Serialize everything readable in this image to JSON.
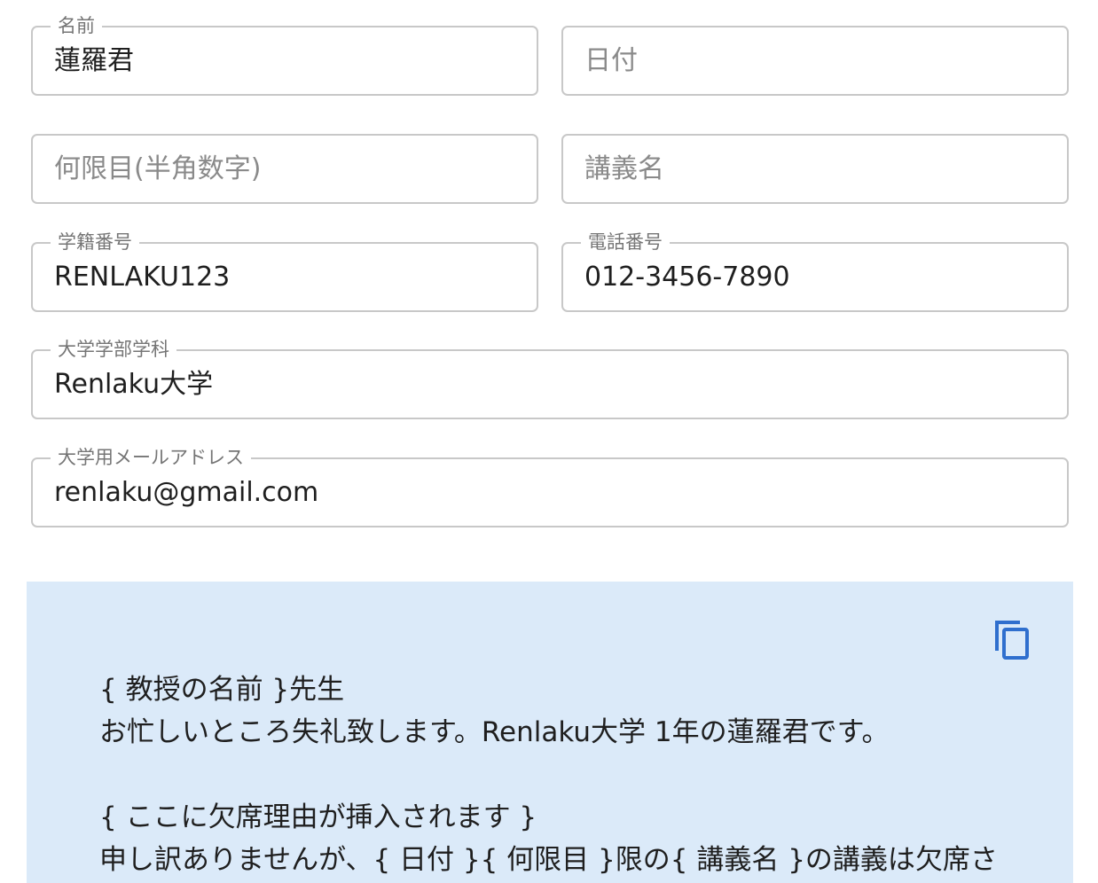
{
  "form": {
    "name": {
      "label": "名前",
      "value": "蓮羅君",
      "placeholder": ""
    },
    "date": {
      "label": "",
      "value": "",
      "placeholder": "日付"
    },
    "period": {
      "label": "",
      "value": "",
      "placeholder": "何限目(半角数字)"
    },
    "lecture": {
      "label": "",
      "value": "",
      "placeholder": "講義名"
    },
    "student_id": {
      "label": "学籍番号",
      "value": "RENLAKU123",
      "placeholder": ""
    },
    "phone": {
      "label": "電話番号",
      "value": "012-3456-7890",
      "placeholder": ""
    },
    "university": {
      "label": "大学学部学科",
      "value": "Renlaku大学",
      "placeholder": ""
    },
    "email": {
      "label": "大学用メールアドレス",
      "value": "renlaku@gmail.com",
      "placeholder": ""
    }
  },
  "message": {
    "copy_icon": "copy-icon",
    "accent_color": "#2f6fce",
    "background_color": "#dbeaf9",
    "lines": [
      "{ 教授の名前 }先生",
      "お忙しいところ失礼致します。Renlaku大学 1年の蓮羅君です。",
      "",
      "{ ここに欠席理由が挿入されます }",
      "申し訳ありませんが、{ 日付 }{ 何限目 }限の{ 講義名 }の講義は欠席さ"
    ]
  }
}
